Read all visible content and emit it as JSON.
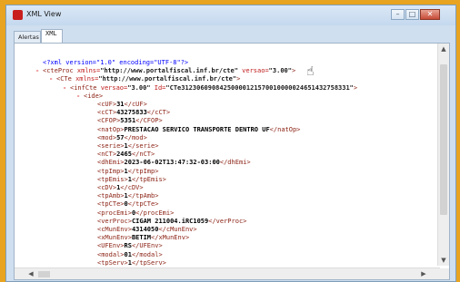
{
  "window": {
    "title": "XML View"
  },
  "tabs": [
    {
      "label": "Alertas"
    },
    {
      "label": "XML"
    }
  ],
  "xml_lines": [
    {
      "indent": 0,
      "minus": false,
      "type": "decl",
      "text": "<?xml version=\"1.0\" encoding=\"UTF-8\"?>"
    },
    {
      "indent": 0,
      "minus": true,
      "type": "open",
      "tag": "cteProc",
      "attrs": [
        {
          "name": "xmlns",
          "value": "http://www.portalfiscal.inf.br/cte"
        },
        {
          "name": "versao",
          "value": "3.00"
        }
      ]
    },
    {
      "indent": 1,
      "minus": true,
      "type": "open",
      "tag": "CTe",
      "attrs": [
        {
          "name": "xmlns",
          "value": "http://www.portalfiscal.inf.br/cte"
        }
      ]
    },
    {
      "indent": 2,
      "minus": true,
      "type": "open",
      "tag": "infCte",
      "attrs": [
        {
          "name": "versao",
          "value": "3.00"
        },
        {
          "name": "Id",
          "value": "CTe31230609084250000121570010000024651432758331"
        }
      ]
    },
    {
      "indent": 3,
      "minus": true,
      "type": "open",
      "tag": "ide",
      "attrs": []
    },
    {
      "indent": 4,
      "minus": false,
      "type": "element",
      "tag": "cUF",
      "value": "31"
    },
    {
      "indent": 4,
      "minus": false,
      "type": "element",
      "tag": "cCT",
      "value": "43275833"
    },
    {
      "indent": 4,
      "minus": false,
      "type": "element",
      "tag": "CFOP",
      "value": "5351"
    },
    {
      "indent": 4,
      "minus": false,
      "type": "element",
      "tag": "natOp",
      "value": "PRESTACAO SERVICO TRANSPORTE DENTRO UF"
    },
    {
      "indent": 4,
      "minus": false,
      "type": "element",
      "tag": "mod",
      "value": "57"
    },
    {
      "indent": 4,
      "minus": false,
      "type": "element",
      "tag": "serie",
      "value": "1"
    },
    {
      "indent": 4,
      "minus": false,
      "type": "element",
      "tag": "nCT",
      "value": "2465"
    },
    {
      "indent": 4,
      "minus": false,
      "type": "element",
      "tag": "dhEmi",
      "value": "2023-06-02T13:47:32-03:00"
    },
    {
      "indent": 4,
      "minus": false,
      "type": "element",
      "tag": "tpImp",
      "value": "1"
    },
    {
      "indent": 4,
      "minus": false,
      "type": "element",
      "tag": "tpEmis",
      "value": "1"
    },
    {
      "indent": 4,
      "minus": false,
      "type": "element",
      "tag": "cDV",
      "value": "1"
    },
    {
      "indent": 4,
      "minus": false,
      "type": "element",
      "tag": "tpAmb",
      "value": "1"
    },
    {
      "indent": 4,
      "minus": false,
      "type": "element",
      "tag": "tpCTe",
      "value": "0"
    },
    {
      "indent": 4,
      "minus": false,
      "type": "element",
      "tag": "procEmi",
      "value": "0"
    },
    {
      "indent": 4,
      "minus": false,
      "type": "element",
      "tag": "verProc",
      "value": "CIGAM 211004.iRC1059"
    },
    {
      "indent": 4,
      "minus": false,
      "type": "element",
      "tag": "cMunEnv",
      "value": "4314050"
    },
    {
      "indent": 4,
      "minus": false,
      "type": "element",
      "tag": "xMunEnv",
      "value": "BETIM"
    },
    {
      "indent": 4,
      "minus": false,
      "type": "element",
      "tag": "UFEnv",
      "value": "RS"
    },
    {
      "indent": 4,
      "minus": false,
      "type": "element",
      "tag": "modal",
      "value": "01"
    },
    {
      "indent": 4,
      "minus": false,
      "type": "element",
      "tag": "tpServ",
      "value": "1"
    }
  ],
  "colors": {
    "background": "#e8a420",
    "window": "#cfdff0",
    "tag": "#8a1f11",
    "attr": "#c01b1b",
    "decl": "#0000ff"
  },
  "icons": {
    "cursor": "hand-pointer-icon",
    "app": "app-icon"
  }
}
